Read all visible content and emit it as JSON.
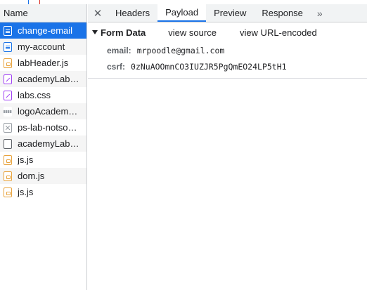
{
  "left_panel": {
    "header": "Name",
    "requests": [
      {
        "name": "change-email",
        "icon": "doc-icon",
        "selected": true
      },
      {
        "name": "my-account",
        "icon": "doc-icon",
        "selected": false
      },
      {
        "name": "labHeader.js",
        "icon": "js-icon",
        "selected": false
      },
      {
        "name": "academyLab…",
        "icon": "css-icon",
        "selected": false
      },
      {
        "name": "labs.css",
        "icon": "css-icon",
        "selected": false
      },
      {
        "name": "logoAcadem…",
        "icon": "image-icon",
        "selected": false
      },
      {
        "name": "ps-lab-notso…",
        "icon": "file-icon",
        "selected": false
      },
      {
        "name": "academyLab…",
        "icon": "blank-file-icon",
        "selected": false
      },
      {
        "name": "js.js",
        "icon": "js-icon",
        "selected": false
      },
      {
        "name": "dom.js",
        "icon": "js-icon",
        "selected": false
      },
      {
        "name": "js.js",
        "icon": "js-icon",
        "selected": false
      }
    ]
  },
  "tabs": {
    "close_glyph": "✕",
    "items": [
      "Headers",
      "Payload",
      "Preview",
      "Response"
    ],
    "active": "Payload",
    "more_glyph": "»"
  },
  "form_data": {
    "title": "Form Data",
    "view_source": "view source",
    "view_url_encoded": "view URL-encoded",
    "params": [
      {
        "key": "email:",
        "value": "mrpoodle@gmail.com"
      },
      {
        "key": "csrf:",
        "value": "0zNuAOOmnCO3IUZJR5PgQmEO24LP5tH1"
      }
    ]
  },
  "colors": {
    "accent": "#1a73e8",
    "selected_text": "#ffffff",
    "js": "#e8a33d",
    "css": "#a142f4"
  }
}
